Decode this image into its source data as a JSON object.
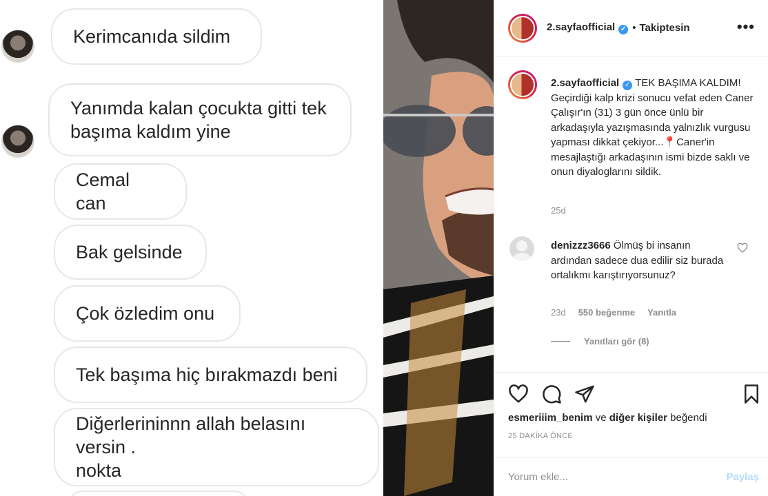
{
  "chat": {
    "messages": [
      {
        "text": "Kerimcanıda sildim"
      },
      {
        "text": "Yanımda kalan çocukta gitti tek\nbaşıma kaldım yine"
      },
      {
        "text": "Cemal can"
      },
      {
        "text": "Bak gelsinde"
      },
      {
        "text": "Çok özledim onu"
      },
      {
        "text": "Tek başıma hiç bırakmazdı beni"
      },
      {
        "text": "Diğerlerininnn allah belasını versin .\nnokta"
      }
    ]
  },
  "post": {
    "header": {
      "username": "2.sayfaofficial",
      "separator": "•",
      "follow_status": "Takiptesin",
      "more_icon": "more-horizontal-icon"
    },
    "caption": {
      "username": "2.sayfaofficial",
      "text": "TEK BAŞIMA KALDIM! Geçirdiği kalp krizi sonucu vefat eden Caner Çalışır'ın (31) 3 gün önce ünlü bir arkadaşıyla yazışmasında yalnızlık vurgusu yapması dikkat çekiyor...📍Caner'in mesajlaştığı arkadaşının ismi bizde saklı ve onun diyaloglarını sildik.",
      "time": "25d"
    },
    "comment": {
      "username": "denizzz3666",
      "text": "Ölmüş bi insanın ardından sadece dua edilir siz burada ortalıkmı karıştırıyorsunuz?",
      "time": "23d",
      "likes": "550 beğenme",
      "reply": "Yanıtla",
      "view_replies": "Yanıtları gör (8)"
    },
    "liked_by": {
      "user": "esmeriiim_benim",
      "connector": "ve",
      "others": "diğer kişiler",
      "suffix": "beğendi"
    },
    "timestamp": "25 DAKİKA ÖNCE",
    "comment_box": {
      "placeholder": "Yorum ekle...",
      "post_label": "Paylaş"
    },
    "colors": {
      "verified": "#3897f0",
      "text": "#262626",
      "muted": "#8e8e8e",
      "post_button_disabled": "#b3dbff"
    }
  }
}
